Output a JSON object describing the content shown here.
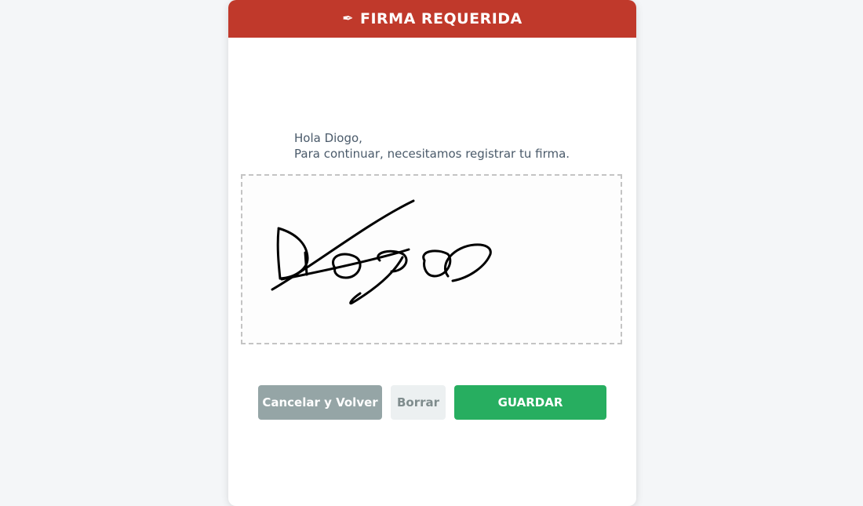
{
  "modal": {
    "icon": "✒",
    "icon_name": "pen-nib-icon",
    "title": "FIRMA REQUERIDA",
    "header_color": "#c0392b"
  },
  "greeting": {
    "line1": "Hola Diogo,",
    "line2": "Para continuar, necesitamos registrar tu firma."
  },
  "signature_pad": {
    "handwritten_signature": "Diogo"
  },
  "buttons": {
    "cancel_label": "Cancelar y Volver",
    "clear_label": "Borrar",
    "save_label": "GUARDAR"
  },
  "colors": {
    "cancel": "#95a5a6",
    "clear": "#ecf0f1",
    "save": "#27ae60"
  }
}
